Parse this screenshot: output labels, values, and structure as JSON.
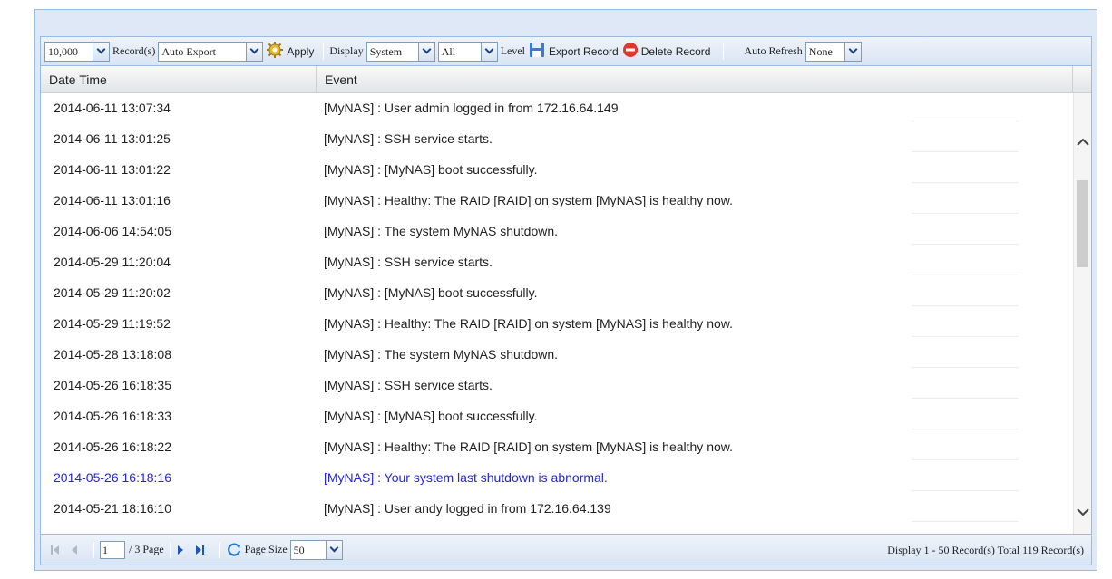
{
  "toolbar": {
    "records_value": "10,000",
    "records_label": "Record(s)",
    "export_mode": "Auto Export",
    "apply_label": "Apply",
    "display_label": "Display",
    "display_value": "System",
    "level_value": "All",
    "level_label": "Level",
    "export_label": "Export Record",
    "delete_label": "Delete Record",
    "refresh_label": "Auto Refresh",
    "refresh_value": "None"
  },
  "grid": {
    "columns": [
      "Date Time",
      "Event"
    ],
    "rows": [
      {
        "time": "2014-06-11 13:07:34",
        "event": "[MyNAS] : User admin logged in from 172.16.64.149"
      },
      {
        "time": "2014-06-11 13:01:25",
        "event": "[MyNAS] : SSH service starts."
      },
      {
        "time": "2014-06-11 13:01:22",
        "event": "[MyNAS] : [MyNAS] boot successfully."
      },
      {
        "time": "2014-06-11 13:01:16",
        "event": "[MyNAS] : Healthy: The RAID [RAID] on system [MyNAS] is healthy now."
      },
      {
        "time": "2014-06-06 14:54:05",
        "event": "[MyNAS] : The system MyNAS shutdown."
      },
      {
        "time": "2014-05-29 11:20:04",
        "event": "[MyNAS] : SSH service starts."
      },
      {
        "time": "2014-05-29 11:20:02",
        "event": "[MyNAS] : [MyNAS] boot successfully."
      },
      {
        "time": "2014-05-29 11:19:52",
        "event": "[MyNAS] : Healthy: The RAID [RAID] on system [MyNAS] is healthy now."
      },
      {
        "time": "2014-05-28 13:18:08",
        "event": "[MyNAS] : The system MyNAS shutdown."
      },
      {
        "time": "2014-05-26 16:18:35",
        "event": "[MyNAS] : SSH service starts."
      },
      {
        "time": "2014-05-26 16:18:33",
        "event": "[MyNAS] : [MyNAS] boot successfully."
      },
      {
        "time": "2014-05-26 16:18:22",
        "event": "[MyNAS] : Healthy: The RAID [RAID] on system [MyNAS] is healthy now."
      },
      {
        "time": "2014-05-26 16:18:16",
        "event": "[MyNAS] : Your system last shutdown is abnormal.",
        "highlight": true
      },
      {
        "time": "2014-05-21 18:16:10",
        "event": "[MyNAS] : User andy logged in from 172.16.64.139"
      }
    ]
  },
  "paging": {
    "page_value": "1",
    "page_total": "/ 3 Page",
    "page_size_label": "Page Size",
    "page_size_value": "50",
    "info": "Display 1 - 50 Record(s) Total 119 Record(s)"
  },
  "colors": {
    "highlight_text": "#2323e6",
    "border": "#99bbe8"
  }
}
